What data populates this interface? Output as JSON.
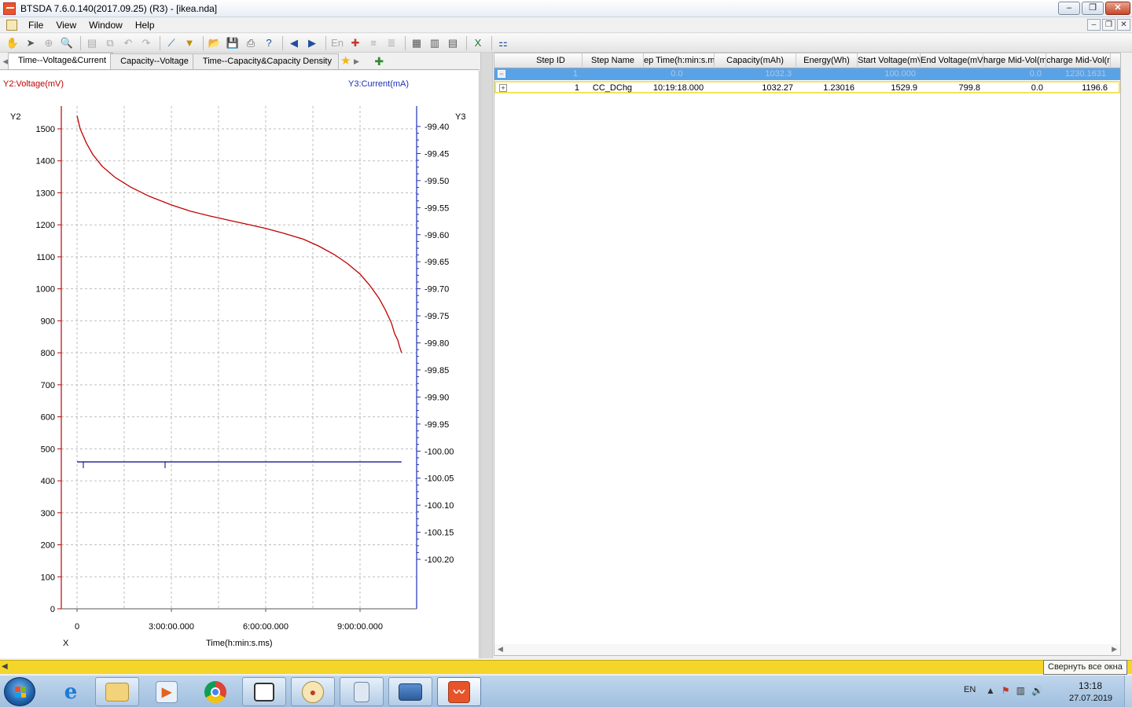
{
  "window": {
    "title": "BTSDA 7.6.0.140(2017.09.25) (R3) - [ikea.nda]",
    "minimize": "‒",
    "restore": "❐",
    "close": "✕"
  },
  "menu": {
    "items": [
      "File",
      "View",
      "Window",
      "Help"
    ],
    "mdi_min": "‒",
    "mdi_restore": "❐",
    "mdi_close": "✕"
  },
  "toolbar": {
    "en_label": "En"
  },
  "chart_tabs": {
    "tabs": [
      "Time--Voltage&Current",
      "Capacity--Voltage",
      "Time--Capacity&Capacity Density"
    ],
    "active_index": 0
  },
  "chart_data": {
    "type": "line",
    "left_axis_title": "Y2:Voltage(mV)",
    "right_axis_title": "Y3:Current(mA)",
    "left_axis_short": "Y2",
    "right_axis_short": "Y3",
    "x_axis_short": "X",
    "xlabel": "Time(h:min:s.ms)",
    "x_ticks": [
      "0",
      "3:00:00.000",
      "6:00:00.000",
      "9:00:00.000"
    ],
    "x_tick_hours": [
      0,
      3,
      6,
      9
    ],
    "xlim_hours": [
      -0.5,
      10.8
    ],
    "y2_ticks": [
      0,
      100,
      200,
      300,
      400,
      500,
      600,
      700,
      800,
      900,
      1000,
      1100,
      1200,
      1300,
      1400,
      1500
    ],
    "y2lim": [
      0,
      1500
    ],
    "y3_ticks": [
      "-99.40",
      "-99.45",
      "-99.50",
      "-99.55",
      "-99.60",
      "-99.65",
      "-99.70",
      "-99.75",
      "-99.80",
      "-99.85",
      "-99.90",
      "-99.95",
      "-100.00",
      "-100.05",
      "-100.10",
      "-100.15",
      "-100.20"
    ],
    "y3lim": [
      -100.2,
      -99.4
    ],
    "grid": true,
    "series": [
      {
        "name": "Voltage",
        "axis": "y2",
        "color": "#c00000",
        "x_hours": [
          0,
          0.1,
          0.3,
          0.5,
          0.8,
          1.2,
          1.7,
          2.3,
          3.0,
          3.6,
          4.2,
          4.8,
          5.4,
          6.0,
          6.6,
          7.2,
          7.7,
          8.2,
          8.6,
          9.0,
          9.3,
          9.6,
          9.8,
          10.0,
          10.1,
          10.2,
          10.25,
          10.32
        ],
        "y_mV": [
          1541,
          1500,
          1455,
          1420,
          1383,
          1349,
          1318,
          1289,
          1262,
          1243,
          1228,
          1215,
          1202,
          1189,
          1173,
          1155,
          1133,
          1106,
          1079,
          1046,
          1012,
          971,
          935,
          893,
          860,
          840,
          822,
          800
        ]
      },
      {
        "name": "Current",
        "axis": "y3",
        "color": "#00008b",
        "x_hours": [
          0,
          10.32
        ],
        "y_mA": [
          -100.02,
          -100.02
        ]
      }
    ]
  },
  "table": {
    "columns": [
      "Step ID",
      "Step Name",
      "ep Time(h:min:s.m",
      "Capacity(mAh)",
      "Energy(Wh)",
      "Start Voltage(mV",
      "End Voltage(mV)",
      "harge Mid-Vol(m",
      "charge Mid-Vol(r"
    ],
    "summary_row": {
      "expander": "−",
      "cells": [
        "1",
        "",
        "0.0",
        "1032.3",
        "",
        "100.000",
        "",
        "0.0",
        "1230.1631"
      ]
    },
    "data_row": {
      "expander": "+",
      "cells": [
        "1",
        "CC_DChg",
        "10:19:18.000",
        "1032.27",
        "1.23016",
        "1529.9",
        "799.8",
        "0.0",
        "1196.6"
      ]
    },
    "scroll_left": "◀",
    "scroll_right": "▶"
  },
  "statusbar": {
    "arrow": "◀",
    "tooltip": "Свернуть все окна"
  },
  "taskbar": {
    "apps": [
      "internet-explorer",
      "file-explorer",
      "media-player",
      "chrome",
      "virtualbox",
      "paint",
      "calculator",
      "screenshot-tool",
      "btsda"
    ],
    "lang": "EN",
    "time": "13:18",
    "date": "27.07.2019"
  }
}
